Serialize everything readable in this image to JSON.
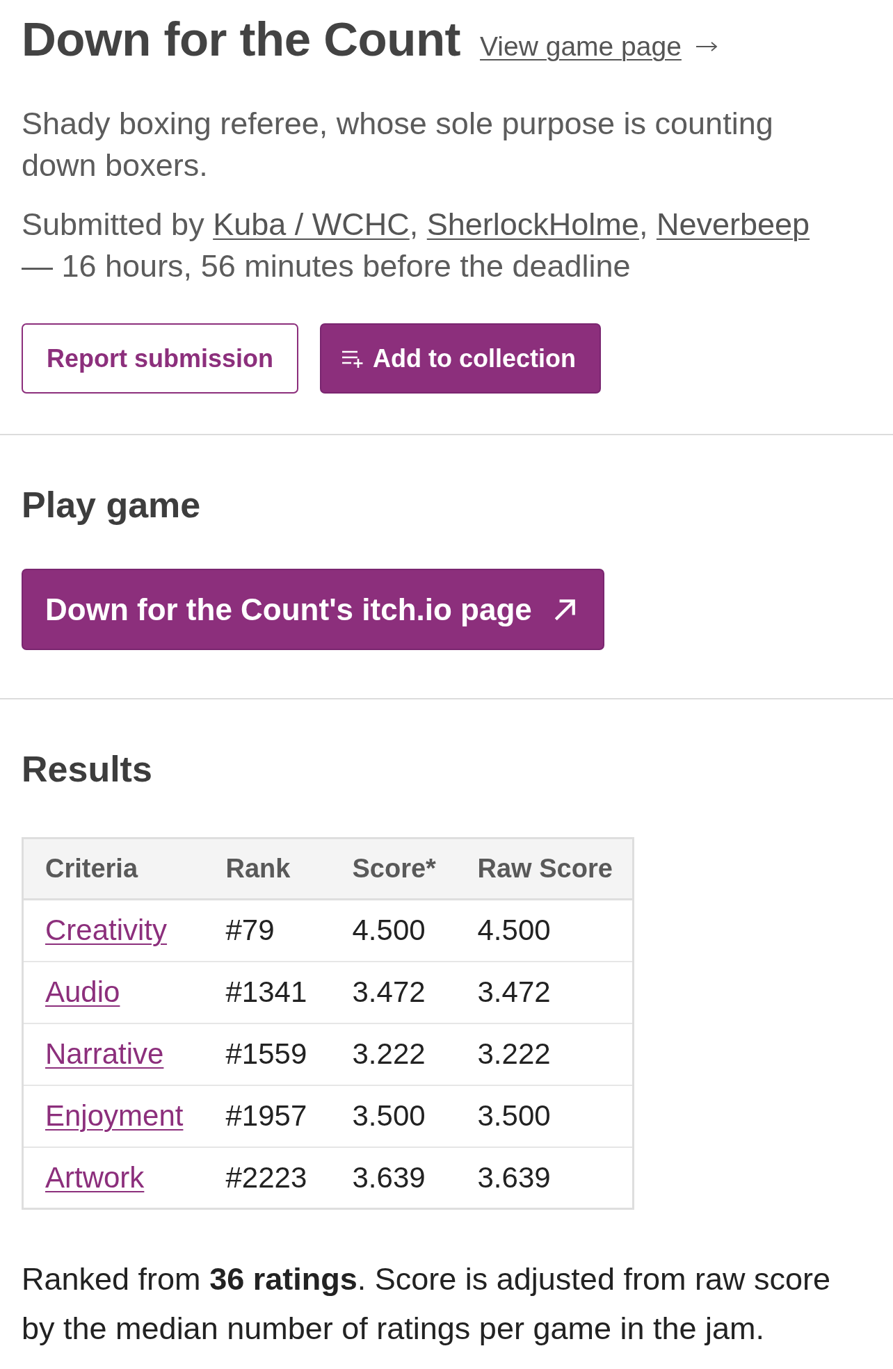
{
  "game": {
    "title": "Down for the Count",
    "view_page_link": "View game page"
  },
  "description": "Shady boxing referee, whose sole purpose is counting down boxers.",
  "submitted": {
    "prefix": "Submitted by",
    "authors": [
      "Kuba / WCHC",
      "SherlockHolme",
      "Neverbeep"
    ],
    "separator": ",",
    "time": "— 16 hours, 56 minutes before the deadline"
  },
  "actions": [
    {
      "label": "Report submission",
      "kind": "outline"
    },
    {
      "label": "Add to collection",
      "kind": "add"
    }
  ],
  "play": {
    "heading": "Play game",
    "button": "Down for the Count's itch.io page"
  },
  "results": {
    "heading": "Results",
    "columns": [
      "Criteria",
      "Rank",
      "Score*",
      "Raw Score"
    ],
    "rows": [
      {
        "criteria": "Creativity",
        "rank": "#79",
        "score": "4.500",
        "raw_score": "4.500"
      },
      {
        "criteria": "Audio",
        "rank": "#1341",
        "score": "3.472",
        "raw_score": "3.472"
      },
      {
        "criteria": "Narrative",
        "rank": "#1559",
        "score": "3.222",
        "raw_score": "3.222"
      },
      {
        "criteria": "Enjoyment",
        "rank": "#1957",
        "score": "3.500",
        "raw_score": "3.500"
      },
      {
        "criteria": "Artwork",
        "rank": "#2223",
        "score": "3.639",
        "raw_score": "3.639"
      }
    ],
    "note": "Ranked from **36 ratings**. Score is adjusted from raw score by the median number of ratings per game in the jam."
  }
}
